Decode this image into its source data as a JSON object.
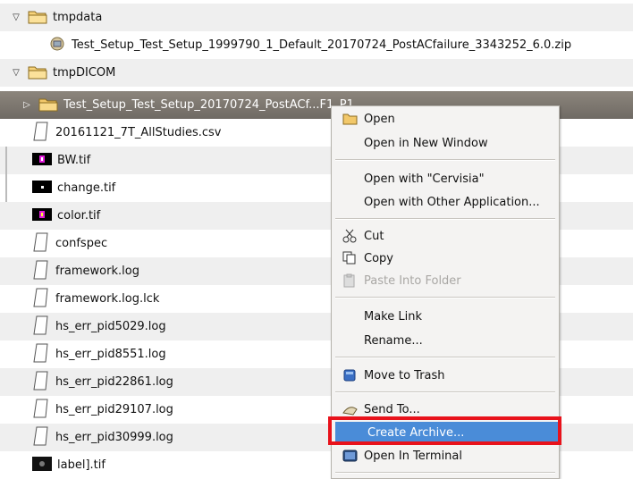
{
  "tree": {
    "rows": [
      {
        "label": "tmpdata",
        "icon": "folder-icon",
        "expander": "▽"
      },
      {
        "label": "Test_Setup_Test_Setup_1999790_1_Default_20170724_PostACfailure_3343252_6.0.zip",
        "icon": "archive-icon"
      },
      {
        "label": "tmpDICOM",
        "icon": "folder-icon",
        "expander": "▽"
      },
      {
        "label": "Test_Setup_Test_Setup_20170724_PostACf...F1_P1",
        "icon": "folder-icon",
        "expander": "▷"
      },
      {
        "label": "20161121_7T_AllStudies.csv",
        "icon": "document-icon"
      },
      {
        "label": "BW.tif",
        "icon": "image-icon"
      },
      {
        "label": "change.tif",
        "icon": "image-icon"
      },
      {
        "label": "color.tif",
        "icon": "image-icon"
      },
      {
        "label": "confspec",
        "icon": "document-icon"
      },
      {
        "label": "framework.log",
        "icon": "document-icon"
      },
      {
        "label": "framework.log.lck",
        "icon": "document-icon"
      },
      {
        "label": "hs_err_pid5029.log",
        "icon": "document-icon"
      },
      {
        "label": "hs_err_pid8551.log",
        "icon": "document-icon"
      },
      {
        "label": "hs_err_pid22861.log",
        "icon": "document-icon"
      },
      {
        "label": "hs_err_pid29107.log",
        "icon": "document-icon"
      },
      {
        "label": "hs_err_pid30999.log",
        "icon": "document-icon"
      },
      {
        "label": "label].tif",
        "icon": "image-icon"
      }
    ]
  },
  "context_menu": {
    "items": [
      {
        "label": "Open",
        "icon": "folder-open-icon"
      },
      {
        "label": "Open in New Window"
      },
      {
        "label": "Open with \"Cervisia\""
      },
      {
        "label": "Open with Other Application..."
      },
      {
        "label": "Cut",
        "icon": "scissors-icon"
      },
      {
        "label": "Copy",
        "icon": "copy-icon"
      },
      {
        "label": "Paste Into Folder",
        "icon": "paste-icon",
        "disabled": true
      },
      {
        "label": "Make Link"
      },
      {
        "label": "Rename..."
      },
      {
        "label": "Move to Trash",
        "icon": "trash-icon"
      },
      {
        "label": "Send To...",
        "icon": "send-icon"
      },
      {
        "label": "Create Archive...",
        "highlighted": true
      },
      {
        "label": "Open In Terminal",
        "icon": "terminal-icon"
      }
    ]
  },
  "colors": {
    "selection": "#7a746d",
    "menu_highlight": "#4a8cd8",
    "annotation_box": "#e8121b"
  }
}
